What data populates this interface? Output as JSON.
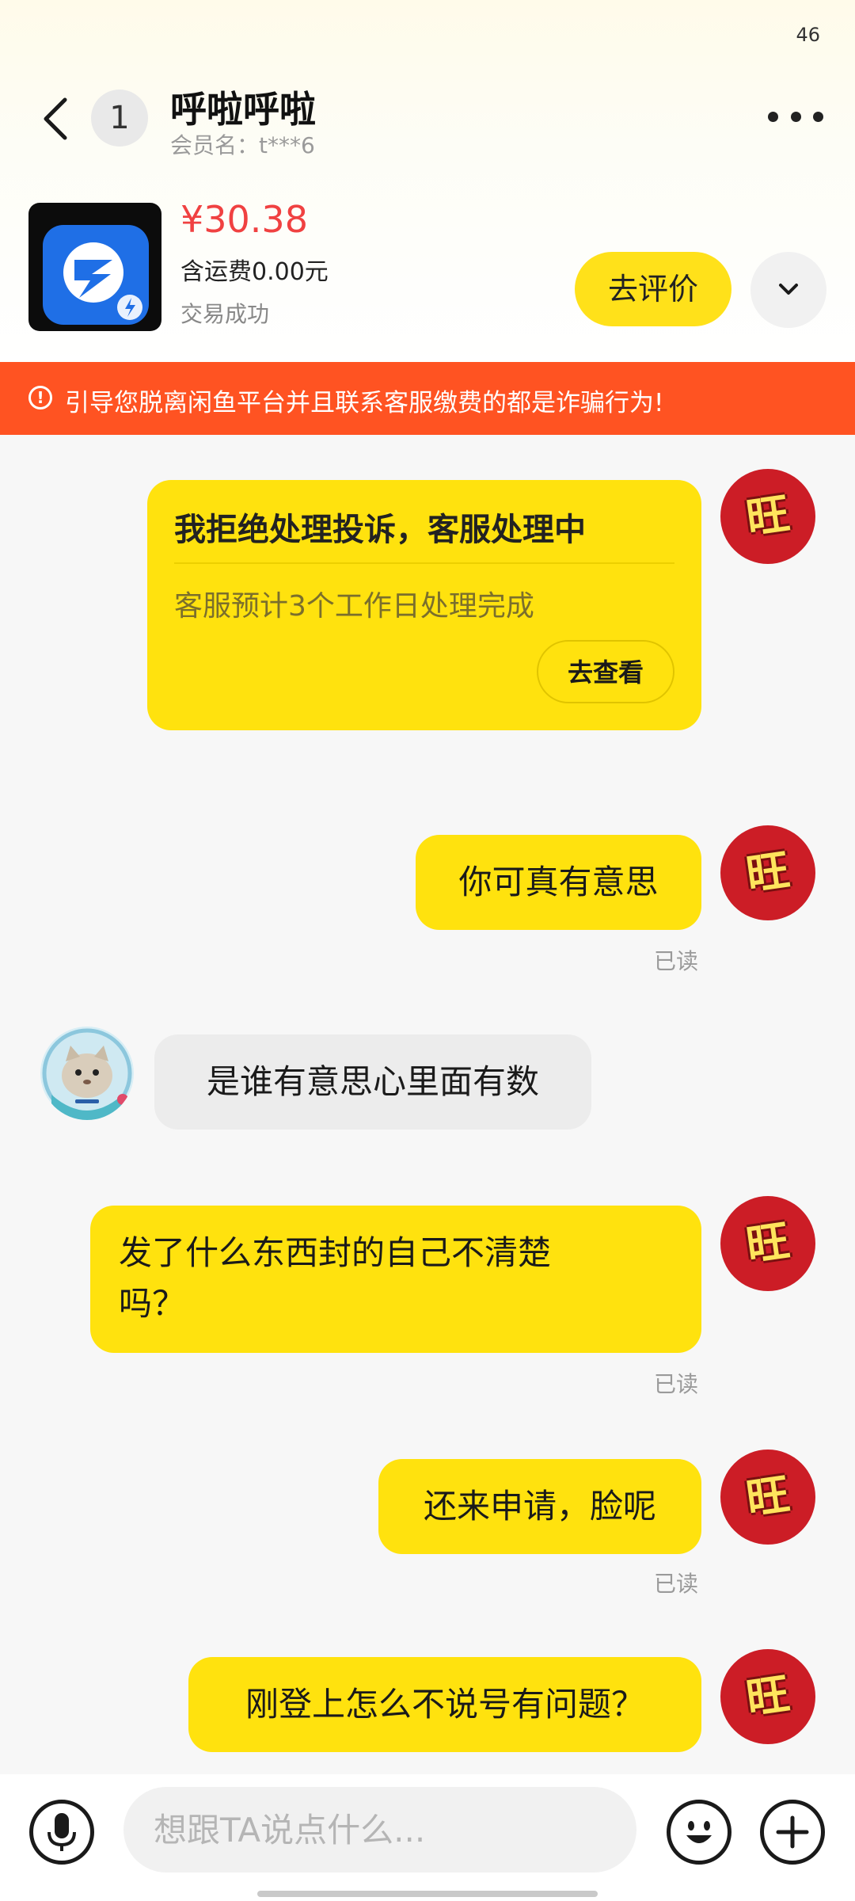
{
  "status_bar": {
    "right_text": "46"
  },
  "header": {
    "unread_count": "1",
    "title": "呼啦呼啦",
    "member_name": "会员名：t***6"
  },
  "product": {
    "price": "¥30.38",
    "shipping": "含运费0.00元",
    "status": "交易成功",
    "review_button": "去评价"
  },
  "warning": {
    "text": "引导您脱离闲鱼平台并且联系客服缴费的都是诈骗行为!"
  },
  "messages": [
    {
      "type": "card",
      "title": "我拒绝处理投诉，客服处理中",
      "desc": "客服预计3个工作日处理完成",
      "button": "去查看",
      "avatar_glyph": "旺"
    },
    {
      "type": "text",
      "from": "me",
      "text": "你可真有意思",
      "read": "已读",
      "avatar_glyph": "旺"
    },
    {
      "type": "text",
      "from": "other",
      "text": "是谁有意思心里面有数"
    },
    {
      "type": "text",
      "from": "me",
      "text": "发了什么东西封的自己不清楚吗？",
      "line1": "发了什么东西封的自己不清楚",
      "line2": "吗？",
      "read": "已读",
      "avatar_glyph": "旺"
    },
    {
      "type": "text",
      "from": "me",
      "text": "还来申请，脸呢",
      "read": "已读",
      "avatar_glyph": "旺"
    },
    {
      "type": "text",
      "from": "me",
      "text": "刚登上怎么不说号有问题？",
      "avatar_glyph": "旺"
    }
  ],
  "input": {
    "placeholder": "想跟TA说点什么..."
  },
  "colors": {
    "accent_yellow": "#ffe20e",
    "warning_red": "#ff5322",
    "price_red": "#f04141",
    "avatar_red": "#cc1d26"
  }
}
